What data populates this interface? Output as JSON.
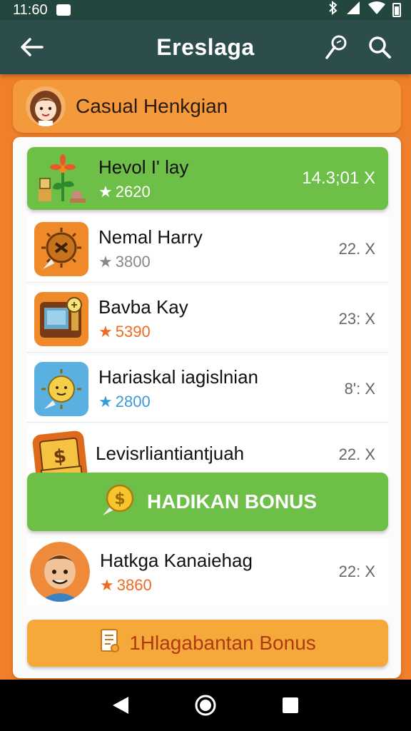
{
  "status_bar": {
    "time": "11:60"
  },
  "app_bar": {
    "title": "Ereslaga",
    "back_icon": "arrow-left-icon",
    "tool_icon": "pin-icon",
    "search_icon": "search-icon"
  },
  "header": {
    "title": "Casual Henkgian"
  },
  "list": [
    {
      "name": "Hevol I' lay",
      "rating": "2620",
      "amount": "14.3;01 X",
      "featured": true,
      "icon": "plant-icon",
      "star_color": "#ffffff"
    },
    {
      "name": "Nemal Harry",
      "rating": "3800",
      "amount": "22. X",
      "featured": false,
      "icon": "sun-spike-icon",
      "star_color": "#888888"
    },
    {
      "name": "Bavba Kay",
      "rating": "5390",
      "amount": "23: X",
      "featured": false,
      "icon": "tv-icon",
      "star_color": "#ef6a1f"
    },
    {
      "name": "Hariaskal iagislnian",
      "rating": "2800",
      "amount": "8': X",
      "featured": false,
      "icon": "sun-face-icon",
      "star_color": "#3a9ad9"
    },
    {
      "name": "Levisrliantiantjuah",
      "rating": "",
      "amount": "22. X",
      "featured": false,
      "icon": "money-icon",
      "star_color": "#888888"
    },
    {
      "name": "Hatkga Kanaiehag",
      "rating": "3860",
      "amount": "22: X",
      "featured": false,
      "icon": "boy-avatar-icon",
      "star_color": "#ef6a1f"
    }
  ],
  "bonus_green": {
    "label": "HADIKAN BONUS",
    "icon": "coin-icon"
  },
  "bonus_orange": {
    "label": "1Hlagabantan Bonus",
    "icon": "document-icon"
  },
  "colors": {
    "accent_green": "#6ebf48",
    "accent_orange": "#f49a3c",
    "app_bar": "#2c4d4c",
    "background": "#ef7f2a"
  }
}
